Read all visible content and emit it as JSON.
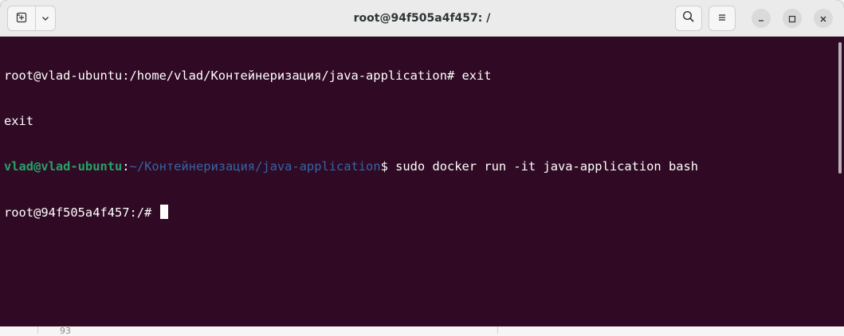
{
  "window": {
    "title": "root@94f505a4f457: /"
  },
  "titlebar": {
    "new_tab_icon": "new-tab-icon",
    "dropdown_icon": "chevron-down-icon",
    "search_icon": "search-icon",
    "menu_icon": "hamburger-menu-icon",
    "minimize_icon": "minimize-icon",
    "maximize_icon": "maximize-icon",
    "close_icon": "close-icon"
  },
  "terminal": {
    "lines": {
      "l1": "root@vlad-ubuntu:/home/vlad/Контейнеризация/java-application# exit",
      "l2": "exit",
      "l3_user": "vlad@vlad-ubuntu",
      "l3_colon": ":",
      "l3_path": "~/Контейнеризация/java-application",
      "l3_cmd": "$ sudo docker run -it java-application bash",
      "l4": "root@94f505a4f457:/# "
    }
  },
  "background": {
    "partial_number": "93"
  },
  "colors": {
    "terminal_bg": "#300a24",
    "terminal_fg": "#ffffff",
    "prompt_user": "#26a269",
    "prompt_path": "#3465a4",
    "titlebar_bg": "#ebebeb"
  }
}
